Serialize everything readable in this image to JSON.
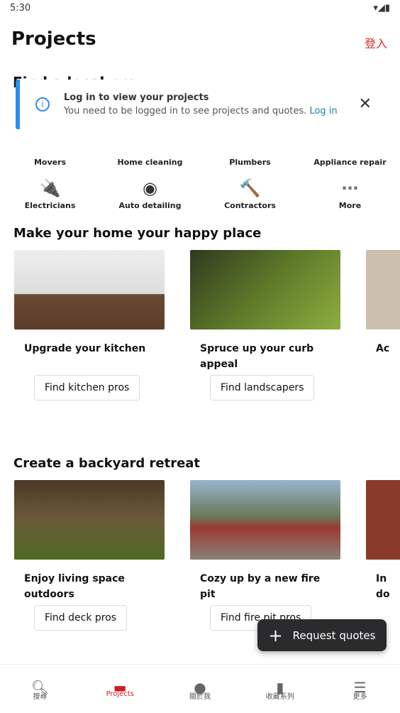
{
  "status": {
    "time": "5:30"
  },
  "header": {
    "title": "Projects",
    "login": "登入"
  },
  "section0_title_partial": "Find a local pro",
  "banner": {
    "title": "Log in to view your projects",
    "body": "You need to be logged in to see projects and quotes.",
    "link": "Log in"
  },
  "categories": [
    {
      "label": "Movers",
      "icon": "truck-icon"
    },
    {
      "label": "Home cleaning",
      "icon": "spray-icon"
    },
    {
      "label": "Plumbers",
      "icon": "wrench-icon"
    },
    {
      "label": "Appliance repair",
      "icon": "appliance-icon"
    },
    {
      "label": "Electricians",
      "icon": "plug-icon"
    },
    {
      "label": "Auto detailing",
      "icon": "tire-icon"
    },
    {
      "label": "Contractors",
      "icon": "hammer-icon"
    },
    {
      "label": "More",
      "icon": "more-icon"
    }
  ],
  "sections": [
    {
      "title": "Make your home your happy place",
      "cards": [
        {
          "caption": "Upgrade your kitchen",
          "button": "Find kitchen pros"
        },
        {
          "caption": "Spruce up your curb appeal",
          "button": "Find landscapers"
        },
        {
          "caption": "Ac"
        }
      ]
    },
    {
      "title": "Create a backyard retreat",
      "cards": [
        {
          "caption": "Enjoy living space outdoors",
          "button": "Find deck pros"
        },
        {
          "caption": "Cozy up by a new fire pit",
          "button": "Find fire pit pros"
        },
        {
          "caption": "In do"
        }
      ]
    }
  ],
  "fab": {
    "label": "Request quotes"
  },
  "nav": [
    {
      "label": "搜尋"
    },
    {
      "label": "Projects"
    },
    {
      "label": "關於我"
    },
    {
      "label": "收藏系列"
    },
    {
      "label": "更多"
    }
  ],
  "colors": {
    "accent": "#d01e25",
    "info": "#2d8cf0",
    "fab": "#2b2b2d"
  }
}
